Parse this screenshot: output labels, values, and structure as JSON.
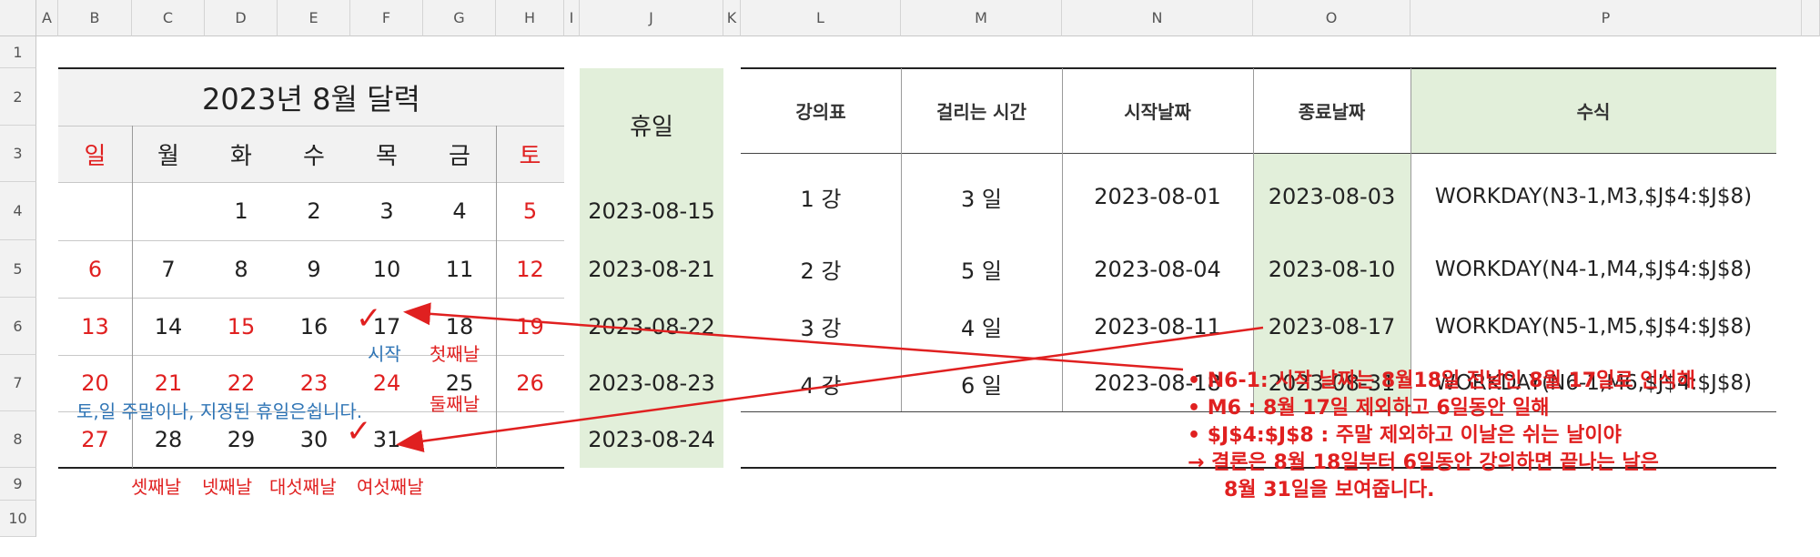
{
  "columns": [
    "A",
    "B",
    "C",
    "D",
    "E",
    "F",
    "G",
    "H",
    "I",
    "J",
    "K",
    "L",
    "M",
    "N",
    "O",
    "P"
  ],
  "rows": [
    "1",
    "2",
    "3",
    "4",
    "5",
    "6",
    "7",
    "8",
    "9",
    "10"
  ],
  "calendar": {
    "title": "2023년 8월 달력",
    "weekdays": [
      "일",
      "월",
      "화",
      "수",
      "목",
      "금",
      "토"
    ],
    "weeks": [
      [
        "",
        "",
        "1",
        "2",
        "3",
        "4",
        "5"
      ],
      [
        "6",
        "7",
        "8",
        "9",
        "10",
        "11",
        "12"
      ],
      [
        "13",
        "14",
        "15",
        "16",
        "17",
        "18",
        "19"
      ],
      [
        "20",
        "21",
        "22",
        "23",
        "24",
        "25",
        "26"
      ],
      [
        "27",
        "28",
        "29",
        "30",
        "31",
        "",
        ""
      ]
    ]
  },
  "holidays": {
    "header": "휴일",
    "dates": [
      "2023-08-15",
      "2023-08-21",
      "2023-08-22",
      "2023-08-23",
      "2023-08-24"
    ]
  },
  "schedule": {
    "headers": [
      "강의표",
      "걸리는 시간",
      "시작날짜",
      "종료날짜",
      "수식"
    ],
    "rows": [
      [
        "1 강",
        "3 일",
        "2023-08-01",
        "2023-08-03",
        "WORKDAY(N3-1,M3,$J$4:$J$8)"
      ],
      [
        "2 강",
        "5 일",
        "2023-08-04",
        "2023-08-10",
        "WORKDAY(N4-1,M4,$J$4:$J$8)"
      ],
      [
        "3 강",
        "4 일",
        "2023-08-11",
        "2023-08-17",
        "WORKDAY(N5-1,M5,$J$4:$J$8)"
      ],
      [
        "4 강",
        "6 일",
        "2023-08-18",
        "2023-08-31",
        "WORKDAY(N6-1,M6,$J$4:$J$8)"
      ]
    ]
  },
  "annotations": {
    "start": "시작",
    "first": "첫째날",
    "second": "둘째날",
    "weekend_note": "토,일 주말이나, 지정된 휴일은쉽니다.",
    "third": "셋째날",
    "fourth": "넷째날",
    "fifth": "대섯째날",
    "sixth": "여섯째날",
    "check": "✓"
  },
  "notes": [
    "• N6-1: 시작 날짜는 8월18일 전날인 8월 17일로 인식해",
    "• M6  : 8월 17일 제외하고 6일동안 일해",
    "• $J$4:$J$8 : 주말 제외하고 이날은 쉬는 날이야",
    "→ 결론은 8월 18일부터 6일동안 강의하면 끝나는 날은",
    "8월 31일을 보여줍니다."
  ],
  "colors": {
    "red": "#e02020",
    "blue": "#2e74b5",
    "green_fill": "#e2efda",
    "grey_fill": "#f2f2f2"
  }
}
